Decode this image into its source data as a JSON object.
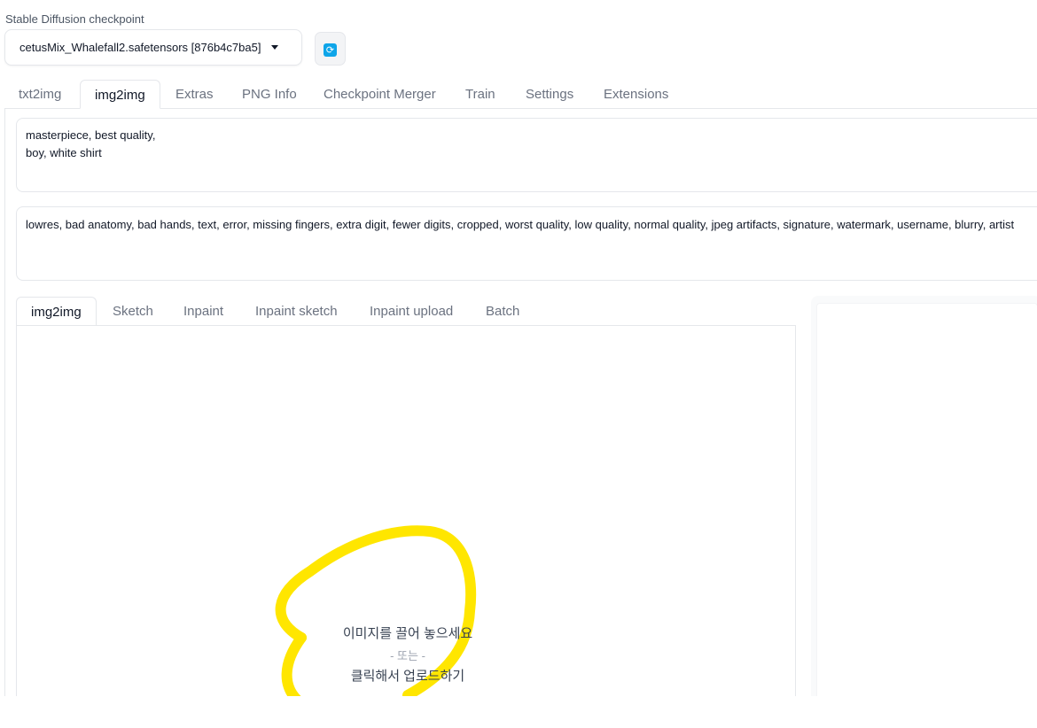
{
  "checkpoint": {
    "label": "Stable Diffusion checkpoint",
    "value": "cetusMix_Whalefall2.safetensors [876b4c7ba5]",
    "refresh_icon": "refresh-icon"
  },
  "main_tabs": [
    "txt2img",
    "img2img",
    "Extras",
    "PNG Info",
    "Checkpoint Merger",
    "Train",
    "Settings",
    "Extensions"
  ],
  "active_main_tab": "img2img",
  "prompt": "masterpiece, best quality,\nboy, white shirt",
  "negative_prompt": "lowres, bad anatomy, bad hands, text, error, missing fingers, extra digit, fewer digits, cropped, worst quality, low quality, normal quality, jpeg artifacts, signature, watermark, username, blurry, artist",
  "sub_tabs": [
    "img2img",
    "Sketch",
    "Inpaint",
    "Inpaint sketch",
    "Inpaint upload",
    "Batch"
  ],
  "active_sub_tab": "img2img",
  "upload": {
    "line1": "이미지를 끌어 놓으세요",
    "or": "- 또는 -",
    "line2": "클릭해서 업로드하기"
  },
  "annotation_color": "#ffe600",
  "accent_color": "#0ea5e9"
}
